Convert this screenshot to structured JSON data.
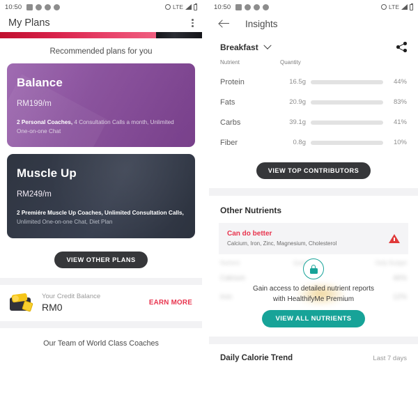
{
  "status_bar": {
    "time": "10:50",
    "left_icons": [
      "message-icon",
      "sync-icon",
      "sync-icon",
      "chat-icon"
    ],
    "network": "LTE",
    "right_icons": [
      "alarm-icon",
      "signal-icon",
      "battery-icon"
    ]
  },
  "left_screen": {
    "appbar": {
      "title": "My Plans",
      "menu_icon": "kebab-menu-icon"
    },
    "recommend_label": "Recommended plans for you",
    "plans": [
      {
        "name": "Balance",
        "price": "RM199/m",
        "features_bold": "2 Personal Coaches,",
        "features_rest": " 4 Consultation Calls a month, Unlimited One-on-one Chat",
        "color": "#8a4f9e"
      },
      {
        "name": "Muscle Up",
        "price": "RM249/m",
        "features_bold": "2 Premiére Muscle Up Coaches, Unlimited Consultation Calls,",
        "features_rest": " Unlimited One-on-one Chat, Diet Plan",
        "color": "#363c4a"
      }
    ],
    "view_other_plans": "VIEW OTHER PLANS",
    "credit": {
      "icon": "wallet-icon",
      "label": "Your Credit Balance",
      "value": "RM0",
      "action": "EARN MORE",
      "action_color": "#e8344e"
    },
    "team_text": "Our Team of World Class Coaches"
  },
  "right_screen": {
    "appbar": {
      "back_icon": "back-arrow-icon",
      "title": "Insights"
    },
    "meal_selector": {
      "value": "Breakfast",
      "chevron": "chevron-down-icon"
    },
    "share_icon": "share-icon",
    "nutrients": {
      "columns": [
        "Nutrient",
        "Quantity"
      ],
      "rows": [
        {
          "name": "Protein",
          "quantity": "16.5g",
          "percent": "44%",
          "pct_value": 44,
          "color": "#f0a22e"
        },
        {
          "name": "Fats",
          "quantity": "20.9g",
          "percent": "83%",
          "pct_value": 83,
          "color": "#8cc63f"
        },
        {
          "name": "Carbs",
          "quantity": "39.1g",
          "percent": "41%",
          "pct_value": 41,
          "color": "#f0a22e"
        },
        {
          "name": "Fiber",
          "quantity": "0.8g",
          "percent": "10%",
          "pct_value": 10,
          "color": "#f0a22e"
        }
      ]
    },
    "view_top_contributors": "VIEW TOP CONTRIBUTORS",
    "other_nutrients_title": "Other Nutrients",
    "alert": {
      "title": "Can do better",
      "subtitle": "Calcium, Iron, Zinc, Magnesium, Cholesterol",
      "icon": "warning-triangle-icon",
      "color": "#e8344e"
    },
    "locked_section": {
      "blurred_columns": [
        "Nutrient",
        "Quantity",
        "Daily Budget"
      ],
      "blurred_rows": [
        {
          "name": "Calcium",
          "quantity": "",
          "budget": "46%"
        },
        {
          "name": "Iron",
          "quantity": "",
          "budget": "12%"
        }
      ],
      "lock_icon": "lock-icon",
      "message": "Gain access to detailed nutrient reports with HealthifyMe Premium",
      "button": "VIEW ALL NUTRIENTS",
      "accent": "#17a398"
    },
    "trend": {
      "title": "Daily Calorie Trend",
      "range": "Last 7 days"
    }
  }
}
